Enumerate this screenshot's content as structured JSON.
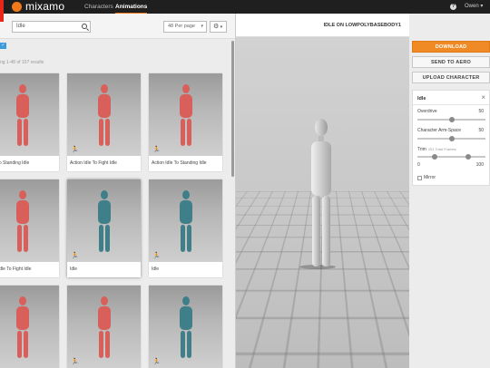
{
  "brand": {
    "name": "mixamo",
    "accent": "#f07a1a"
  },
  "nav": {
    "items": [
      {
        "label": "Characters"
      },
      {
        "label": "Animations"
      }
    ]
  },
  "user": {
    "name": "Owen"
  },
  "search": {
    "value": "Idle"
  },
  "perpage": {
    "selected": "48 Per page"
  },
  "results": {
    "count_text": "ng 1-48 of 107 results"
  },
  "cards": [
    {
      "label": "Idle To Standing Idle"
    },
    {
      "label": "Action Idle To Fight Idle"
    },
    {
      "label": "Action Idle To Standing Idle"
    },
    {
      "label": "ding Idle To Fight Idle"
    },
    {
      "label": "Idle"
    },
    {
      "label": "Idle"
    },
    {
      "label": ""
    },
    {
      "label": ""
    },
    {
      "label": ""
    }
  ],
  "viewer": {
    "title": "IDLE ON LOWPOLYBASEBODY1"
  },
  "actions": {
    "download": "DOWNLOAD",
    "send_to_aero": "SEND TO AERO",
    "upload_character": "UPLOAD CHARACTER"
  },
  "settings": {
    "title": "Idle",
    "overdrive": {
      "label": "Overdrive",
      "value": "50",
      "level": 0.5
    },
    "arm_space": {
      "label": "Character Arm-Space",
      "value": "50",
      "level": 0.5
    },
    "trim": {
      "label": "Trim",
      "sub": "251 Total Frames",
      "min": "0",
      "max": "100",
      "start_level": 0.25,
      "end_level": 0.75
    },
    "mirror": {
      "label": "Mirror",
      "checked": false
    }
  },
  "colors": {
    "figure_red": "#d9605a",
    "figure_teal": "#3f7f8a",
    "primary_button": "#f08a24"
  }
}
